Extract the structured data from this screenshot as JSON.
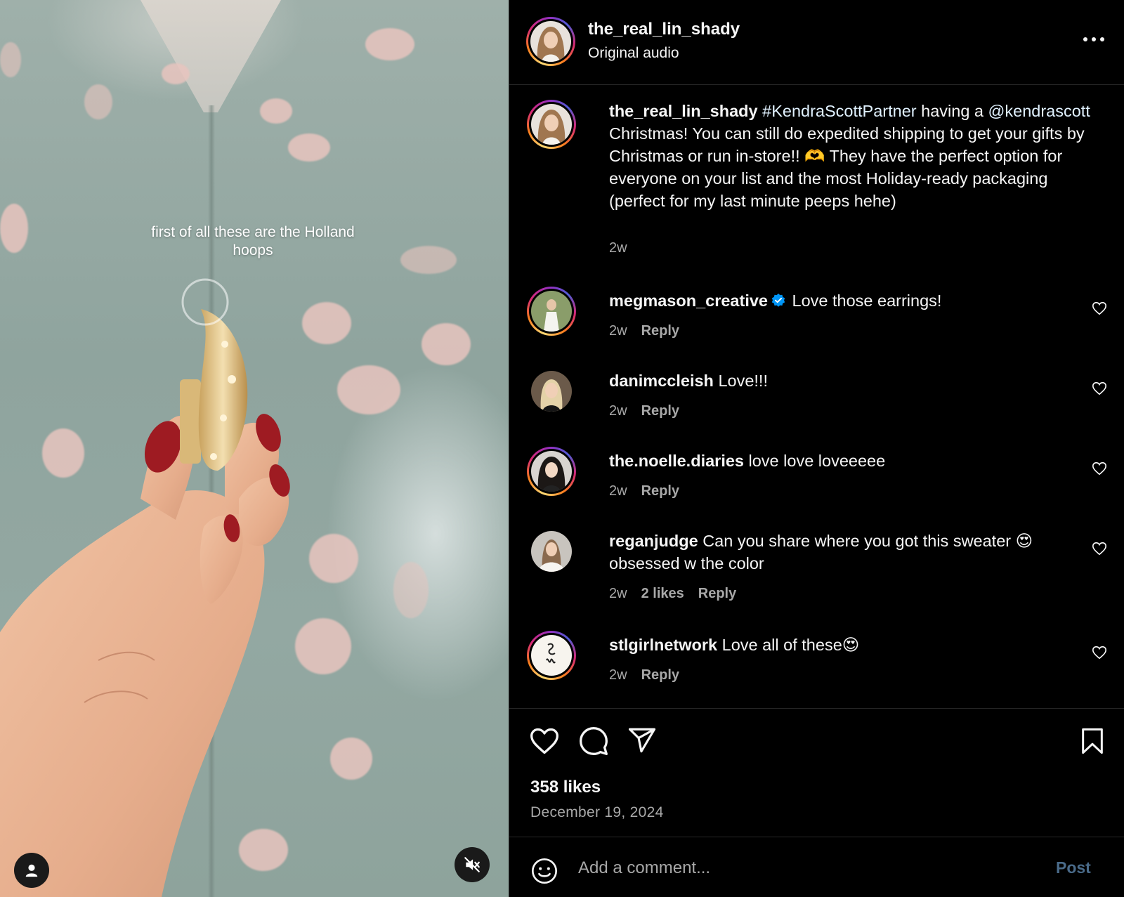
{
  "video": {
    "caption_overlay": "first of all these are the Holland hoops",
    "user_icon": "person-icon",
    "mute_icon": "speaker-muted-icon"
  },
  "header": {
    "username": "the_real_lin_shady",
    "audio": "Original audio",
    "more_icon": "more-horizontal-icon"
  },
  "caption": {
    "username": "the_real_lin_shady",
    "hashtag": "#KendraScottPartner",
    "text_1": " having a ",
    "mention": "@kendrascott",
    "text_2": " Christmas! You can still do expedited shipping to get your gifts by Christmas or run in-store!! 🫶 They have the perfect option for everyone on your list and the most Holiday-ready packaging (perfect for my last minute peeps hehe)",
    "time": "2w"
  },
  "comments": [
    {
      "username": "megmason_creative",
      "verified": true,
      "text": "Love those earrings!",
      "time": "2w",
      "likes": "",
      "reply": "Reply"
    },
    {
      "username": "danimccleish",
      "verified": false,
      "text": "Love!!!",
      "time": "2w",
      "likes": "",
      "reply": "Reply"
    },
    {
      "username": "the.noelle.diaries",
      "verified": false,
      "text": "love love loveeeee",
      "time": "2w",
      "likes": "",
      "reply": "Reply"
    },
    {
      "username": "reganjudge",
      "verified": false,
      "text": "Can you share where you got this sweater 😍 obsessed w the color",
      "time": "2w",
      "likes": "2 likes",
      "reply": "Reply"
    },
    {
      "username": "stlgirlnetwork",
      "verified": false,
      "text": "Love all of these😍",
      "time": "2w",
      "likes": "",
      "reply": "Reply"
    }
  ],
  "actions": {
    "like_icon": "heart-icon",
    "comment_icon": "comment-bubble-icon",
    "share_icon": "paper-plane-icon",
    "save_icon": "bookmark-icon"
  },
  "stats": {
    "likes": "358 likes",
    "date": "December 19, 2024"
  },
  "composer": {
    "placeholder": "Add a comment...",
    "post_label": "Post",
    "emoji_icon": "smiley-icon"
  },
  "colors": {
    "background": "#000000",
    "secondary_text": "#a8a8a8",
    "divider": "#262626",
    "verified_blue": "#0095f6",
    "post_button_disabled": "#4a6b8a"
  }
}
